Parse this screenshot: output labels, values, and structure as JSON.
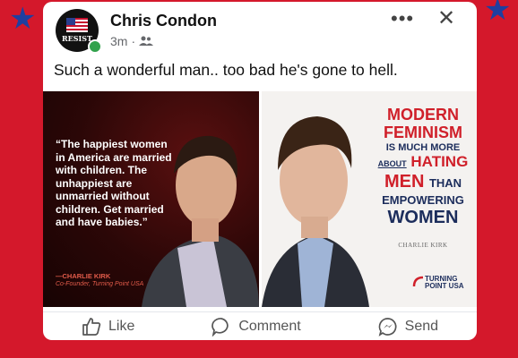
{
  "post": {
    "author": "Chris Condon",
    "time": "3m",
    "audience_icon": "friends-icon",
    "text": "Such a wonderful man.. too bad he's gone to hell.",
    "avatar_text": "RESIST"
  },
  "image_left": {
    "quote": "“The happiest women in America are married with children. The unhappiest are unmarried without children. Get married and have babies.”",
    "attribution": "—CHARLIE KIRK",
    "role": "Co-Founder, Turning Point USA"
  },
  "image_right": {
    "line1": "MODERN",
    "line2": "FEMINISM",
    "line3": "IS MUCH MORE",
    "line4a": "ABOUT",
    "line4b": "HATING",
    "line5a": "MEN",
    "line5b": "THAN",
    "line6": "EMPOWERING",
    "line7": "WOMEN",
    "author": "CHARLIE KIRK",
    "logo_line1": "TURNING",
    "logo_line2": "POINT USA"
  },
  "actions": {
    "like": "Like",
    "comment": "Comment",
    "send": "Send"
  },
  "colors": {
    "background": "#d4182b",
    "stars": "#1f3fa0"
  }
}
